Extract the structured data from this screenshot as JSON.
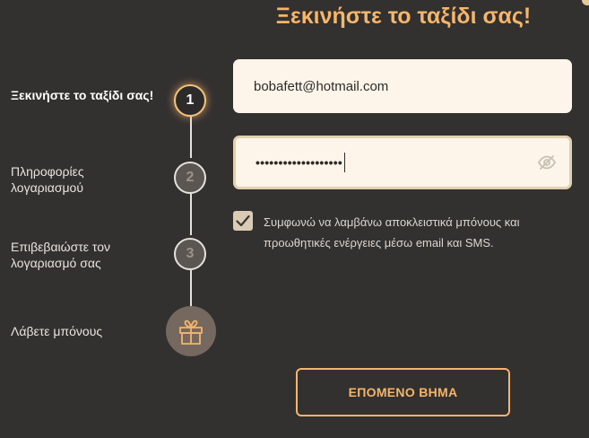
{
  "header": {
    "title": "Ξεκινήστε το ταξίδι σας!"
  },
  "steps": [
    {
      "label": "Ξεκινήστε το ταξίδι σας!",
      "number": "1",
      "state": "active"
    },
    {
      "label": "Πληροφορίες λογαριασμού",
      "number": "2",
      "state": "inactive"
    },
    {
      "label": "Επιβεβαιώστε τον λογαριασμό σας",
      "number": "3",
      "state": "inactive"
    },
    {
      "label": "Λάβετε μπόνους",
      "icon": "gift-icon",
      "state": "inactive"
    }
  ],
  "form": {
    "email_value": "bobafett@hotmail.com",
    "password_masked": "•••••••••••••••••••",
    "password_toggle_icon": "eye-slash-icon",
    "consent_checked": true,
    "consent_text": "Συμφωνώ να λαμβάνω αποκλειστικά μπόνους και προωθητικές ενέργειες μέσω email και SMS."
  },
  "actions": {
    "next_label": "ΕΠΟΜΕΝΟ ΒΗΜΑ"
  },
  "colors": {
    "accent": "#f5b56a",
    "background": "#333030",
    "field": "#fdf5e9"
  }
}
